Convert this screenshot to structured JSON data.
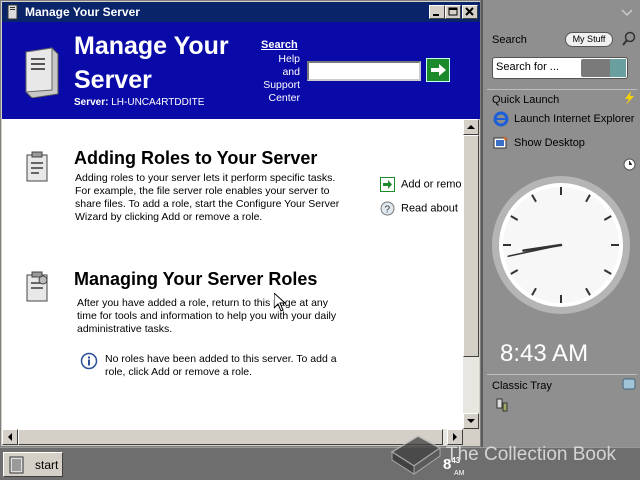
{
  "window": {
    "title": "Manage Your Server"
  },
  "header": {
    "title_line1": "Manage Your",
    "title_line2": "Server",
    "server_label": "Server:",
    "server_name": "LH-UNCA4RTDDITE",
    "search_label": "Search",
    "help_line1": "Help",
    "help_line2": "and",
    "help_line3": "Support",
    "help_line4": "Center",
    "search_value": ""
  },
  "sections": [
    {
      "title": "Adding Roles to Your Server",
      "body": "Adding roles to your server lets it perform specific tasks. For example, the file server role enables your server to share files. To add a role, start the Configure Your Server Wizard by clicking Add or remove a role."
    },
    {
      "title": "Managing Your Server Roles",
      "body": "After you have added a role, return to this page at any time for tools and information to help you with your daily administrative tasks."
    }
  ],
  "actions": {
    "add_remove": "Add or remo",
    "read_about": "Read about"
  },
  "note": "No roles have been added to this server. To add a role, click Add or remove a role.",
  "sidebar": {
    "search_title": "Search",
    "my_stuff": "My Stuff",
    "search_placeholder": "Search for ...",
    "quick_launch_title": "Quick Launch",
    "quick_launch_items": [
      "Launch Internet Explorer",
      "Show Desktop"
    ],
    "clock_time": "8:43 AM",
    "clock_hour": 8,
    "clock_minute": 43,
    "classic_tray_title": "Classic Tray"
  },
  "taskbar": {
    "start_label": "start",
    "time_hour": "8",
    "time_minute": "43",
    "time_ampm": "AM"
  },
  "watermark": {
    "text": "The Collection Book"
  },
  "colors": {
    "titlebar": "#0a246a",
    "header": "#0a0aa8",
    "sidebar": "#8f8f8f"
  }
}
